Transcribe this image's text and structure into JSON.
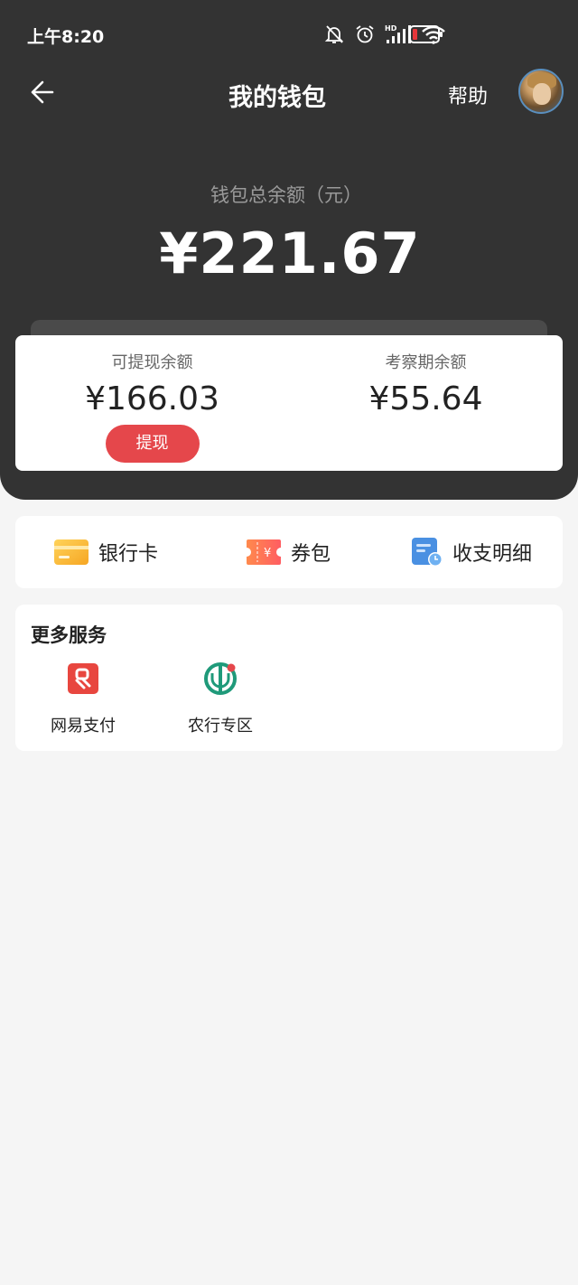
{
  "status_bar": {
    "time": "上午8:20"
  },
  "nav": {
    "title": "我的钱包",
    "help": "帮助"
  },
  "wallet": {
    "total_label": "钱包总余额（元）",
    "total_amount": "¥221.67",
    "withdrawable_label": "可提现余额",
    "withdrawable_amount": "¥166.03",
    "withdraw_button": "提现",
    "review_label": "考察期余额",
    "review_amount": "¥55.64"
  },
  "quick_actions": [
    {
      "label": "银行卡",
      "icon": "bank-card-icon"
    },
    {
      "label": "券包",
      "icon": "coupon-icon"
    },
    {
      "label": "收支明细",
      "icon": "statement-icon"
    }
  ],
  "services": {
    "title": "更多服务",
    "items": [
      {
        "label": "网易支付",
        "icon": "netease-pay-icon"
      },
      {
        "label": "农行专区",
        "icon": "abc-bank-icon"
      }
    ]
  },
  "colors": {
    "header_bg": "#333333",
    "accent_red": "#e5474b",
    "page_bg": "#f5f5f5"
  }
}
